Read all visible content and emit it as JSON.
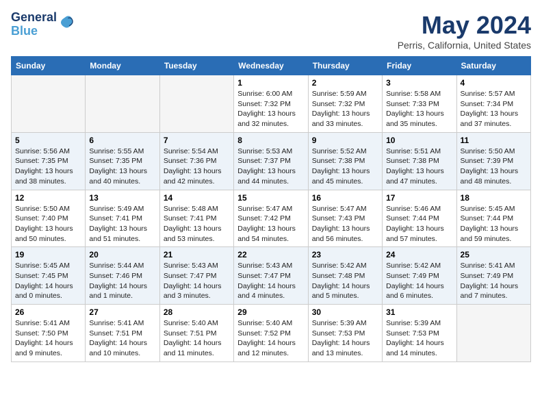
{
  "header": {
    "logo_line1": "General",
    "logo_line2": "Blue",
    "month": "May 2024",
    "location": "Perris, California, United States"
  },
  "days_of_week": [
    "Sunday",
    "Monday",
    "Tuesday",
    "Wednesday",
    "Thursday",
    "Friday",
    "Saturday"
  ],
  "weeks": [
    [
      {
        "day": "",
        "info": ""
      },
      {
        "day": "",
        "info": ""
      },
      {
        "day": "",
        "info": ""
      },
      {
        "day": "1",
        "info": "Sunrise: 6:00 AM\nSunset: 7:32 PM\nDaylight: 13 hours\nand 32 minutes."
      },
      {
        "day": "2",
        "info": "Sunrise: 5:59 AM\nSunset: 7:32 PM\nDaylight: 13 hours\nand 33 minutes."
      },
      {
        "day": "3",
        "info": "Sunrise: 5:58 AM\nSunset: 7:33 PM\nDaylight: 13 hours\nand 35 minutes."
      },
      {
        "day": "4",
        "info": "Sunrise: 5:57 AM\nSunset: 7:34 PM\nDaylight: 13 hours\nand 37 minutes."
      }
    ],
    [
      {
        "day": "5",
        "info": "Sunrise: 5:56 AM\nSunset: 7:35 PM\nDaylight: 13 hours\nand 38 minutes."
      },
      {
        "day": "6",
        "info": "Sunrise: 5:55 AM\nSunset: 7:35 PM\nDaylight: 13 hours\nand 40 minutes."
      },
      {
        "day": "7",
        "info": "Sunrise: 5:54 AM\nSunset: 7:36 PM\nDaylight: 13 hours\nand 42 minutes."
      },
      {
        "day": "8",
        "info": "Sunrise: 5:53 AM\nSunset: 7:37 PM\nDaylight: 13 hours\nand 44 minutes."
      },
      {
        "day": "9",
        "info": "Sunrise: 5:52 AM\nSunset: 7:38 PM\nDaylight: 13 hours\nand 45 minutes."
      },
      {
        "day": "10",
        "info": "Sunrise: 5:51 AM\nSunset: 7:38 PM\nDaylight: 13 hours\nand 47 minutes."
      },
      {
        "day": "11",
        "info": "Sunrise: 5:50 AM\nSunset: 7:39 PM\nDaylight: 13 hours\nand 48 minutes."
      }
    ],
    [
      {
        "day": "12",
        "info": "Sunrise: 5:50 AM\nSunset: 7:40 PM\nDaylight: 13 hours\nand 50 minutes."
      },
      {
        "day": "13",
        "info": "Sunrise: 5:49 AM\nSunset: 7:41 PM\nDaylight: 13 hours\nand 51 minutes."
      },
      {
        "day": "14",
        "info": "Sunrise: 5:48 AM\nSunset: 7:41 PM\nDaylight: 13 hours\nand 53 minutes."
      },
      {
        "day": "15",
        "info": "Sunrise: 5:47 AM\nSunset: 7:42 PM\nDaylight: 13 hours\nand 54 minutes."
      },
      {
        "day": "16",
        "info": "Sunrise: 5:47 AM\nSunset: 7:43 PM\nDaylight: 13 hours\nand 56 minutes."
      },
      {
        "day": "17",
        "info": "Sunrise: 5:46 AM\nSunset: 7:44 PM\nDaylight: 13 hours\nand 57 minutes."
      },
      {
        "day": "18",
        "info": "Sunrise: 5:45 AM\nSunset: 7:44 PM\nDaylight: 13 hours\nand 59 minutes."
      }
    ],
    [
      {
        "day": "19",
        "info": "Sunrise: 5:45 AM\nSunset: 7:45 PM\nDaylight: 14 hours\nand 0 minutes."
      },
      {
        "day": "20",
        "info": "Sunrise: 5:44 AM\nSunset: 7:46 PM\nDaylight: 14 hours\nand 1 minute."
      },
      {
        "day": "21",
        "info": "Sunrise: 5:43 AM\nSunset: 7:47 PM\nDaylight: 14 hours\nand 3 minutes."
      },
      {
        "day": "22",
        "info": "Sunrise: 5:43 AM\nSunset: 7:47 PM\nDaylight: 14 hours\nand 4 minutes."
      },
      {
        "day": "23",
        "info": "Sunrise: 5:42 AM\nSunset: 7:48 PM\nDaylight: 14 hours\nand 5 minutes."
      },
      {
        "day": "24",
        "info": "Sunrise: 5:42 AM\nSunset: 7:49 PM\nDaylight: 14 hours\nand 6 minutes."
      },
      {
        "day": "25",
        "info": "Sunrise: 5:41 AM\nSunset: 7:49 PM\nDaylight: 14 hours\nand 7 minutes."
      }
    ],
    [
      {
        "day": "26",
        "info": "Sunrise: 5:41 AM\nSunset: 7:50 PM\nDaylight: 14 hours\nand 9 minutes."
      },
      {
        "day": "27",
        "info": "Sunrise: 5:41 AM\nSunset: 7:51 PM\nDaylight: 14 hours\nand 10 minutes."
      },
      {
        "day": "28",
        "info": "Sunrise: 5:40 AM\nSunset: 7:51 PM\nDaylight: 14 hours\nand 11 minutes."
      },
      {
        "day": "29",
        "info": "Sunrise: 5:40 AM\nSunset: 7:52 PM\nDaylight: 14 hours\nand 12 minutes."
      },
      {
        "day": "30",
        "info": "Sunrise: 5:39 AM\nSunset: 7:53 PM\nDaylight: 14 hours\nand 13 minutes."
      },
      {
        "day": "31",
        "info": "Sunrise: 5:39 AM\nSunset: 7:53 PM\nDaylight: 14 hours\nand 14 minutes."
      },
      {
        "day": "",
        "info": ""
      }
    ]
  ]
}
